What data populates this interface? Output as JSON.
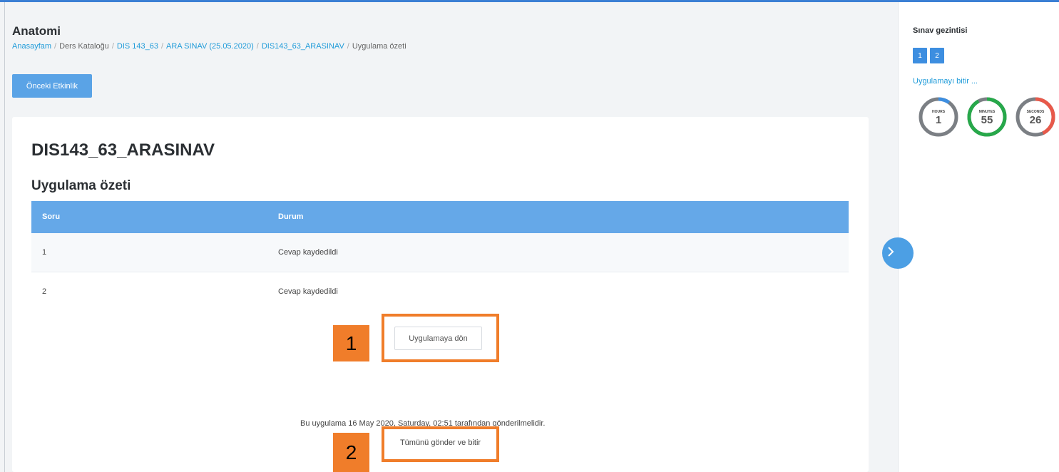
{
  "header": {
    "course_title": "Anatomi",
    "breadcrumb": [
      {
        "label": "Anasayfam",
        "link": true
      },
      {
        "label": "Ders Kataloğu",
        "link": false
      },
      {
        "label": "DIS 143_63",
        "link": true
      },
      {
        "label": "ARA SINAV (25.05.2020)",
        "link": true
      },
      {
        "label": "DIS143_63_ARASINAV",
        "link": true
      },
      {
        "label": "Uygulama özeti",
        "link": false
      }
    ],
    "prev_activity_label": "Önceki Etkinlik"
  },
  "main": {
    "quiz_title": "DIS143_63_ARASINAV",
    "summary_title": "Uygulama özeti",
    "table": {
      "columns": [
        "Soru",
        "Durum"
      ],
      "rows": [
        {
          "question": "1",
          "status": "Cevap kaydedildi"
        },
        {
          "question": "2",
          "status": "Cevap kaydedildi"
        }
      ]
    },
    "return_button_label": "Uygulamaya dön",
    "deadline_text": "Bu uygulama 16 May 2020, Saturday, 02:51 tarafından gönderilmelidir.",
    "submit_button_label": "Tümünü gönder ve bitir"
  },
  "annotations": {
    "marker1": "1",
    "marker2": "2",
    "highlight_color": "#f07d2a"
  },
  "sidebar": {
    "nav_title": "Sınav gezintisi",
    "question_buttons": [
      "1",
      "2"
    ],
    "finish_link": "Uygulamayı bitir ...",
    "timers": [
      {
        "label": "HOURS",
        "value": "1",
        "color": "#3d8ee0",
        "fraction": 0.1
      },
      {
        "label": "MINUTES",
        "value": "55",
        "color": "#27a84a",
        "fraction": 0.92
      },
      {
        "label": "SECONDS",
        "value": "26",
        "color": "#e8594a",
        "fraction": 0.43
      }
    ]
  },
  "colors": {
    "accent": "#5aa3e6",
    "table_header": "#65a8e8",
    "link": "#1f9bd9"
  }
}
